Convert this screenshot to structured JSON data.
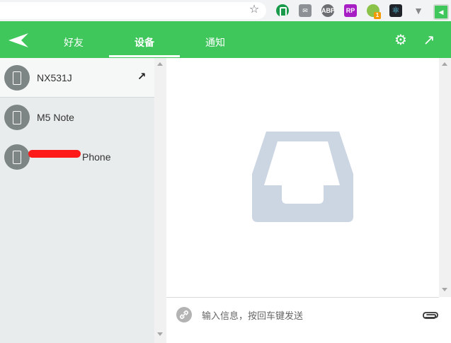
{
  "browser": {
    "star_icon": "star-icon",
    "extensions": [
      {
        "name": "ext-onenote-icon",
        "label": "",
        "color": "#1a9b4b"
      },
      {
        "name": "ext-mail-icon",
        "label": "",
        "color": "#8d9196"
      },
      {
        "name": "ext-adblock-icon",
        "label": "ABP",
        "color": "#6d6e71"
      },
      {
        "name": "ext-rp-icon",
        "label": "RP",
        "color": "#a61ec4"
      },
      {
        "name": "ext-extra-icon",
        "label": "",
        "color": "#8bc34a",
        "badge": "1"
      },
      {
        "name": "ext-react-icon",
        "label": "",
        "color": "#20232a"
      },
      {
        "name": "ext-vue-icon",
        "label": "",
        "color": "#888888"
      },
      {
        "name": "ext-pushbullet-icon",
        "label": "",
        "color": "#3fc75c"
      }
    ]
  },
  "header": {
    "tabs": [
      {
        "label": "好友",
        "active": false
      },
      {
        "label": "设备",
        "active": true
      },
      {
        "label": "通知",
        "active": false
      }
    ],
    "accent": "#3fc75c"
  },
  "devices": [
    {
      "name": "NX531J",
      "active": true
    },
    {
      "name": "M5 Note",
      "active": false
    },
    {
      "name": "Phone",
      "active": false
    }
  ],
  "composer": {
    "placeholder": "输入信息，按回车键发送"
  }
}
